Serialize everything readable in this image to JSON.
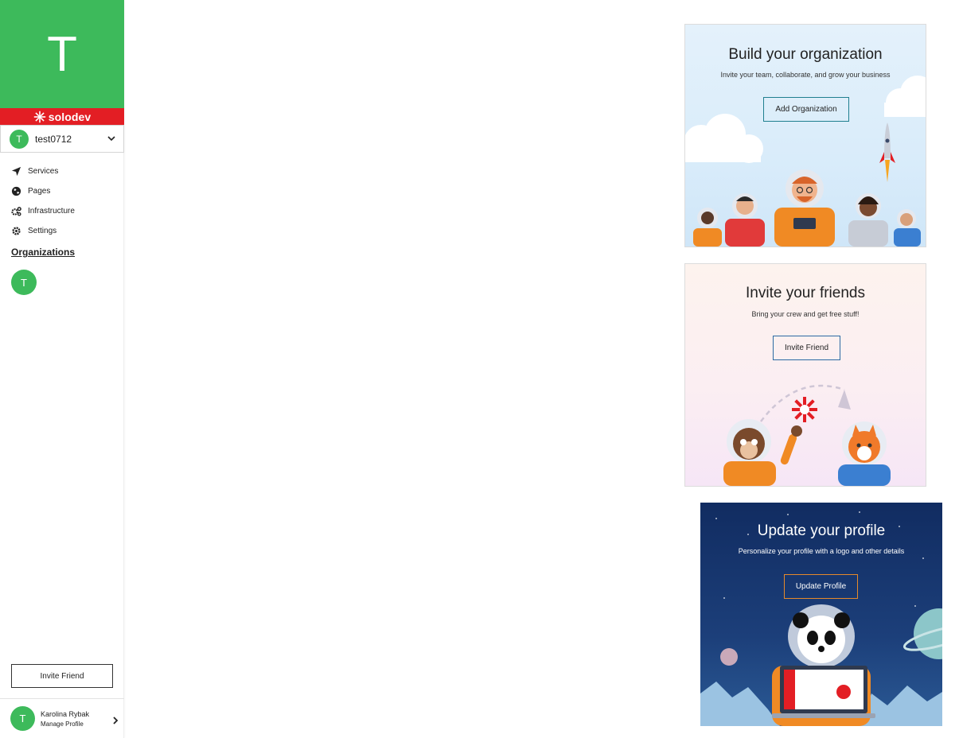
{
  "sidebar": {
    "org_letter": "T",
    "brand": "solodev",
    "org_select": {
      "avatar_letter": "T",
      "name": "test0712"
    },
    "nav": [
      {
        "label": "Services",
        "icon": "location-arrow-icon"
      },
      {
        "label": "Pages",
        "icon": "globe-icon"
      },
      {
        "label": "Infrastructure",
        "icon": "cogs-icon"
      },
      {
        "label": "Settings",
        "icon": "gear-icon"
      }
    ],
    "organizations_heading": "Organizations",
    "org_avatar_letter": "T",
    "invite_button": "Invite Friend",
    "profile": {
      "avatar_letter": "T",
      "name": "Karolina Rybak",
      "manage": "Manage Profile"
    }
  },
  "cards": {
    "organization": {
      "title": "Build your organization",
      "subtitle": "Invite your team, collaborate, and grow your business",
      "button": "Add Organization"
    },
    "friends": {
      "title": "Invite your friends",
      "subtitle": "Bring your crew and get free stuff!",
      "button": "Invite Friend"
    },
    "profile": {
      "title": "Update your profile",
      "subtitle": "Personalize your profile with a logo and other details",
      "button": "Update Profile"
    }
  },
  "colors": {
    "brand_green": "#3dba5b",
    "brand_red": "#e31e24",
    "org_button_border": "#1f7f8f",
    "friend_button_border": "#2b6aa3",
    "profile_button_border": "#e58a2b",
    "profile_card_bg": "#112c61"
  }
}
